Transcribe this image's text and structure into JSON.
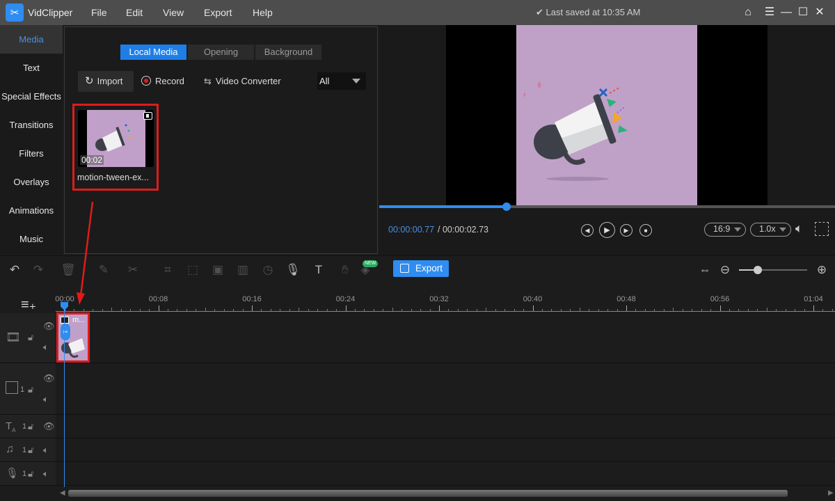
{
  "app": {
    "name": "VidClipper",
    "saved_status": "Last saved at 10:35 AM"
  },
  "menu": [
    "File",
    "Edit",
    "View",
    "Export",
    "Help"
  ],
  "window_controls": [
    "home-icon",
    "menu-icon",
    "minimize-icon",
    "maximize-icon",
    "close-icon"
  ],
  "sidebar": {
    "items": [
      {
        "label": "Media",
        "active": true
      },
      {
        "label": "Text"
      },
      {
        "label": "Special Effects"
      },
      {
        "label": "Transitions"
      },
      {
        "label": "Filters"
      },
      {
        "label": "Overlays"
      },
      {
        "label": "Animations"
      },
      {
        "label": "Music"
      }
    ]
  },
  "media_panel": {
    "tabs": [
      "Local Media",
      "Opening",
      "Background"
    ],
    "active_tab": "Local Media",
    "actions": {
      "import": "Import",
      "record": "Record",
      "converter": "Video Converter"
    },
    "filter": {
      "selected": "All"
    },
    "items": [
      {
        "name": "motion-tween-ex...",
        "duration": "00:02",
        "selected": true
      }
    ]
  },
  "preview": {
    "current_time": "00:00:00.77",
    "total_time": "/ 00:00:02.73",
    "progress_fraction": 0.28,
    "aspect_ratio": "16:9",
    "speed": "1.0x",
    "colors": {
      "accent": "#2f8cf0",
      "video_bg": "#bfa1c8"
    }
  },
  "toolbar": {
    "tools": [
      "undo",
      "redo",
      "delete",
      "edit",
      "cut",
      "crop",
      "mosaic",
      "freeze",
      "audio-wave",
      "duration",
      "record-voice",
      "text-to-speech",
      "green-screen",
      "pin"
    ],
    "new_badge": "NEW",
    "export_label": "Export",
    "zoom_level_fraction": 0.28
  },
  "timeline": {
    "ruler_labels": [
      "00:00",
      "00:08",
      "00:16",
      "00:24",
      "00:32",
      "00:40",
      "00:48",
      "00:56",
      "01:04"
    ],
    "clip": {
      "title": "m..."
    },
    "tracks": [
      {
        "type": "video",
        "icon": "film-icon",
        "number": ""
      },
      {
        "type": "overlay",
        "icon": "picture-in-picture-icon",
        "number": "1"
      },
      {
        "type": "text",
        "icon": "text-icon",
        "number": "1"
      },
      {
        "type": "music",
        "icon": "music-icon",
        "number": "1"
      },
      {
        "type": "voiceover",
        "icon": "microphone-icon",
        "number": "1"
      }
    ]
  }
}
